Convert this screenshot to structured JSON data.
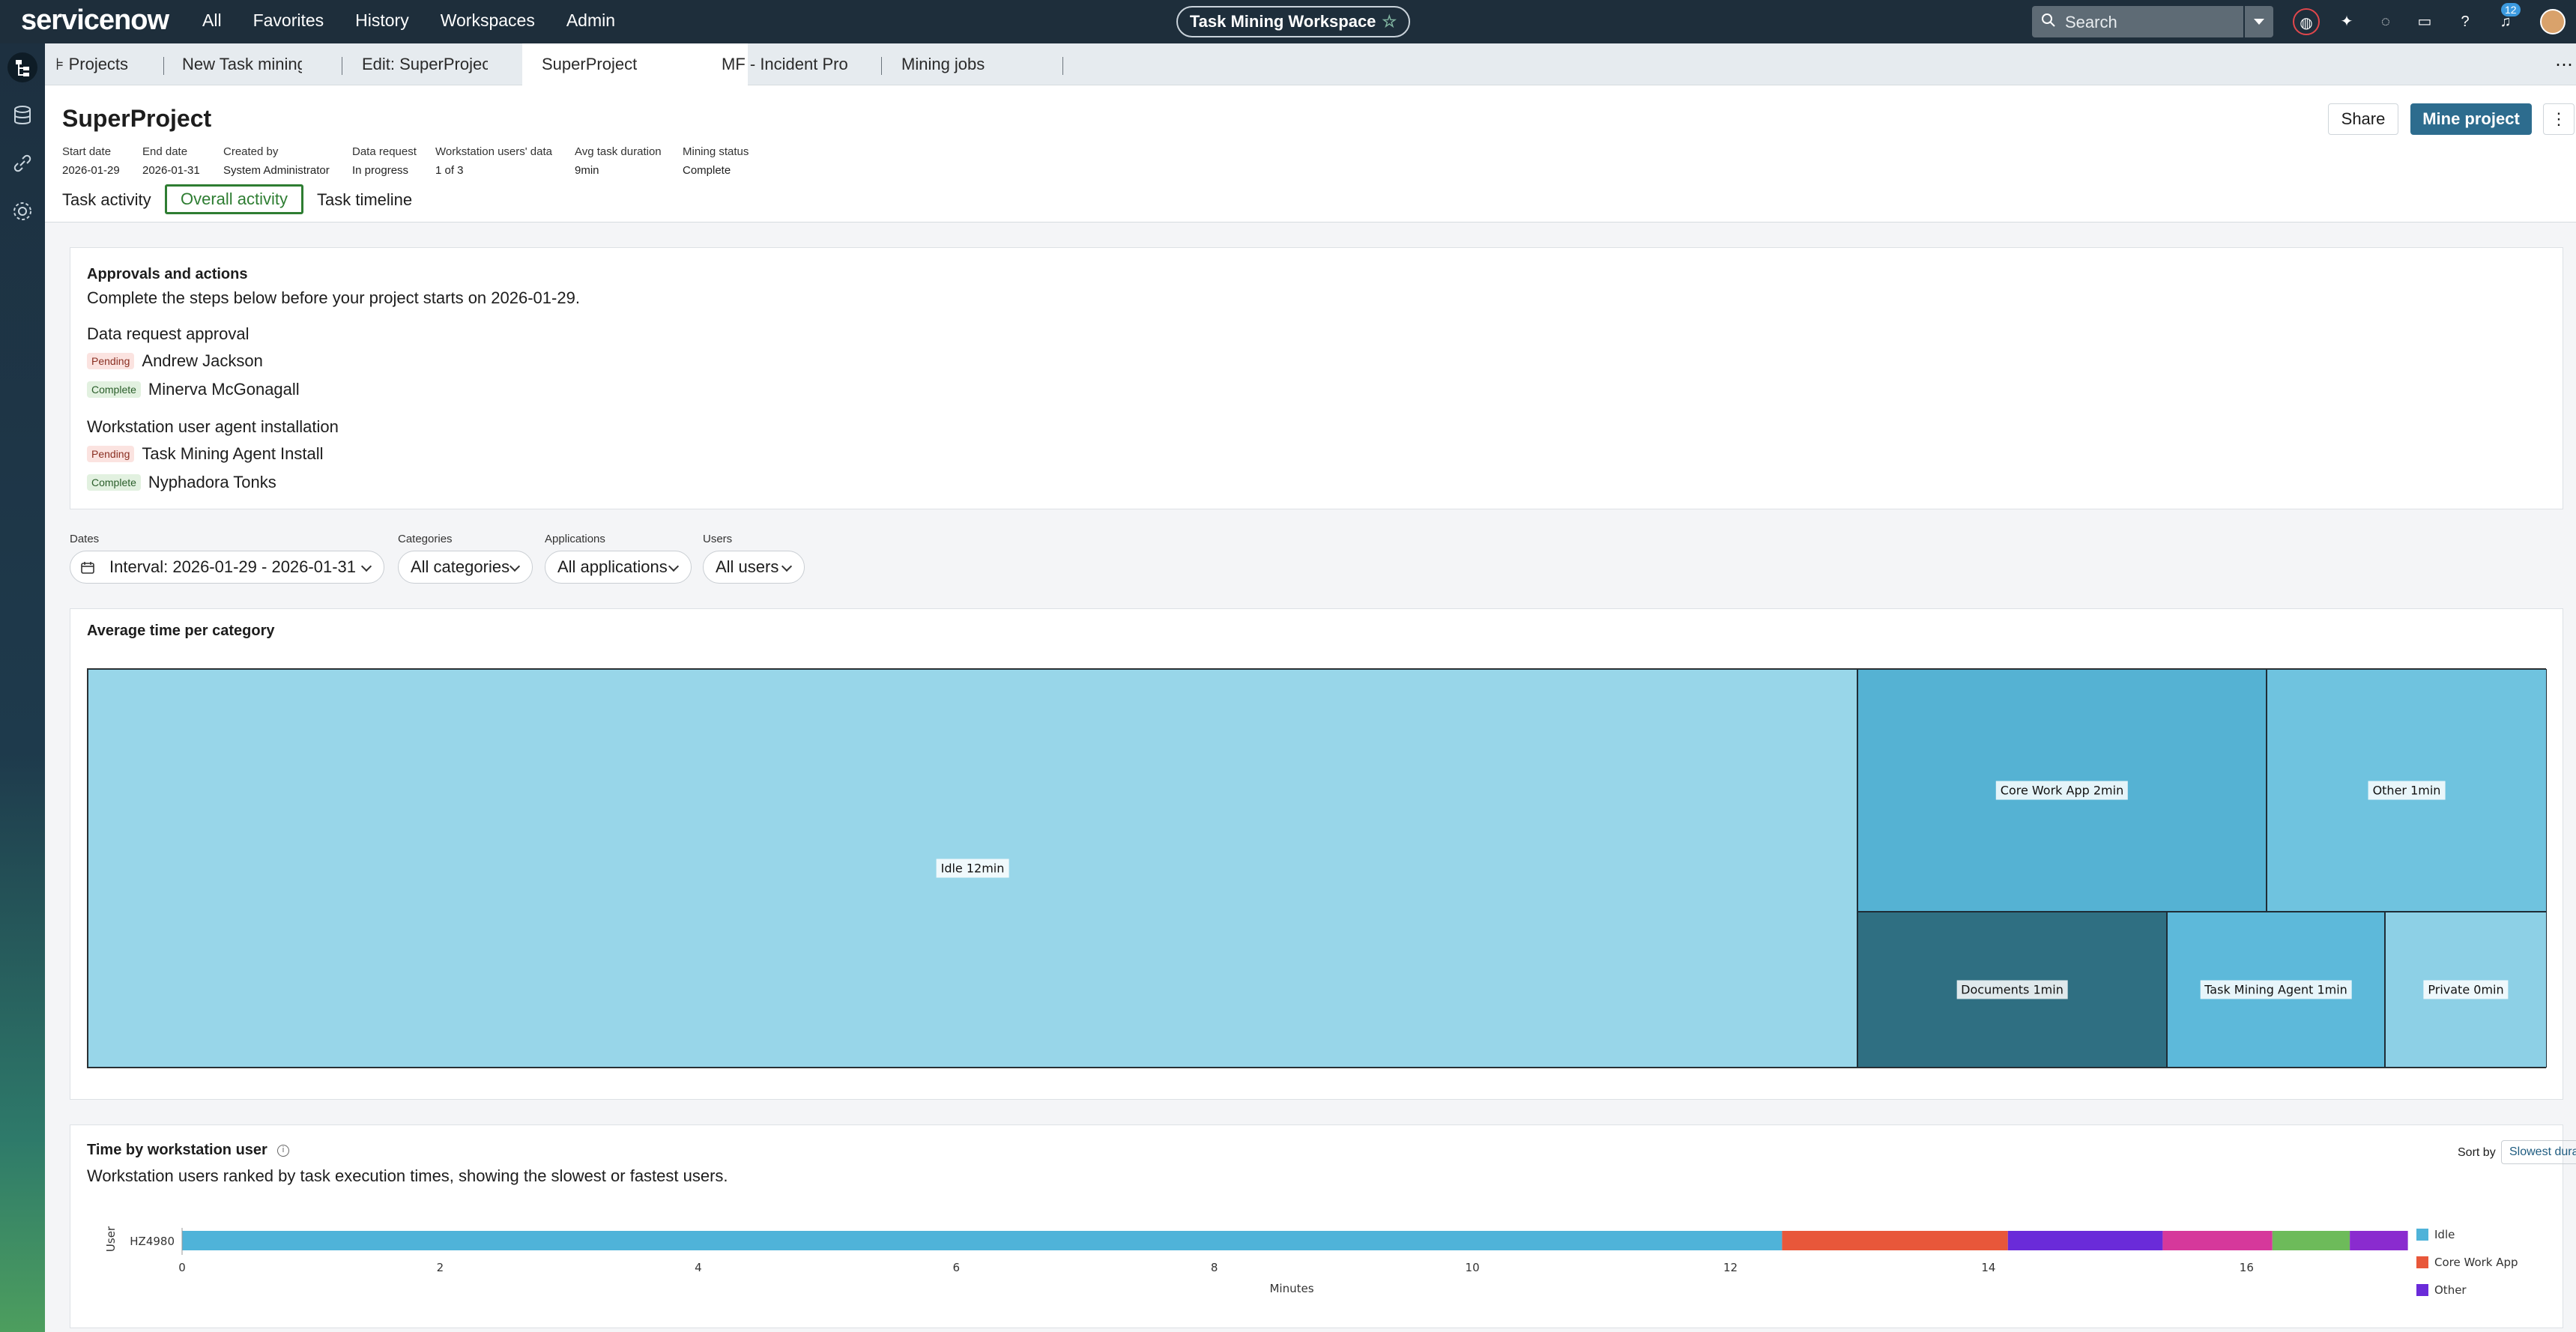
{
  "topbar": {
    "logo_text": "servicenow",
    "nav": [
      "All",
      "Favorites",
      "History",
      "Workspaces",
      "Admin"
    ],
    "workspace_title": "Task Mining Workspace",
    "search_placeholder": "Search",
    "notification_count": "12"
  },
  "tabs": [
    {
      "label": "Projects"
    },
    {
      "label": "New Task mining"
    },
    {
      "label": "Edit: SuperProject"
    },
    {
      "label": "SuperProject"
    },
    {
      "label": "MF - Incident Pro"
    },
    {
      "label": "Mining jobs"
    }
  ],
  "project": {
    "title": "SuperProject",
    "meta": [
      {
        "label": "Start date",
        "value": "2026-01-29"
      },
      {
        "label": "End date",
        "value": "2026-01-31"
      },
      {
        "label": "Created by",
        "value": "System Administrator"
      },
      {
        "label": "Data request",
        "value": "In progress"
      },
      {
        "label": "Workstation users' data",
        "value": "1 of 3"
      },
      {
        "label": "Avg task duration",
        "value": "9min"
      },
      {
        "label": "Mining status",
        "value": "Complete"
      }
    ],
    "subtabs": [
      "Task activity",
      "Overall activity",
      "Task timeline"
    ],
    "share_label": "Share",
    "mine_label": "Mine project",
    "kebab": "⋮"
  },
  "approvals": {
    "heading": "Approvals and actions",
    "subtitle": "Complete the steps below before your project starts on 2026-01-29.",
    "sections": [
      {
        "title": "Data request approval",
        "rows": [
          {
            "status": "Pending",
            "name": "Andrew Jackson"
          },
          {
            "status": "Complete",
            "name": "Minerva McGonagall"
          }
        ]
      },
      {
        "title": "Workstation user agent installation",
        "rows": [
          {
            "status": "Pending",
            "name": "Task Mining Agent Install"
          },
          {
            "status": "Complete",
            "name": "Nyphadora Tonks"
          }
        ]
      }
    ]
  },
  "filters": [
    {
      "label": "Dates",
      "value": "Interval: 2026-01-29 - 2026-01-31"
    },
    {
      "label": "Categories",
      "value": "All categories"
    },
    {
      "label": "Applications",
      "value": "All applications"
    },
    {
      "label": "Users",
      "value": "All users"
    }
  ],
  "treemap": {
    "title": "Average time per category",
    "cells": [
      {
        "label": "Idle 12min",
        "color": "#98d6e9"
      },
      {
        "label": "Core Work App 2min",
        "color": "#55b2d3"
      },
      {
        "label": "Other 1min",
        "color": "#6fc3df"
      },
      {
        "label": "Documents 1min",
        "color": "#2f6f82"
      },
      {
        "label": "Task Mining Agent 1min",
        "color": "#5db9da"
      },
      {
        "label": "Private 0min",
        "color": "#8dd0e6"
      }
    ]
  },
  "bottom": {
    "title": "Time by workstation user",
    "subtitle": "Workstation users ranked by task execution times, showing the slowest or fastest users.",
    "sort_label": "Sort by",
    "sort_value": "Slowest duration",
    "info": "i"
  },
  "chart_data": {
    "type": "bar",
    "orientation": "horizontal",
    "stacked": true,
    "categories": [
      "HZ4980"
    ],
    "xlabel": "Minutes",
    "ylabel": "User",
    "xlim": [
      0,
      17.2
    ],
    "xticks": [
      0,
      2,
      4,
      6,
      8,
      10,
      12,
      14,
      16
    ],
    "legend": "right",
    "series": [
      {
        "name": "Idle",
        "values": [
          12.4
        ],
        "color": "#4fb3d9"
      },
      {
        "name": "Core Work App",
        "values": [
          1.75
        ],
        "color": "#e8573a"
      },
      {
        "name": "Other",
        "values": [
          1.2
        ],
        "color": "#6a2bd9"
      },
      {
        "values": [
          0.85
        ],
        "color": "#d6389b"
      },
      {
        "values": [
          0.6
        ],
        "color": "#6dbb5a"
      },
      {
        "values": [
          0.45
        ],
        "color": "#8a2bcf"
      }
    ]
  }
}
